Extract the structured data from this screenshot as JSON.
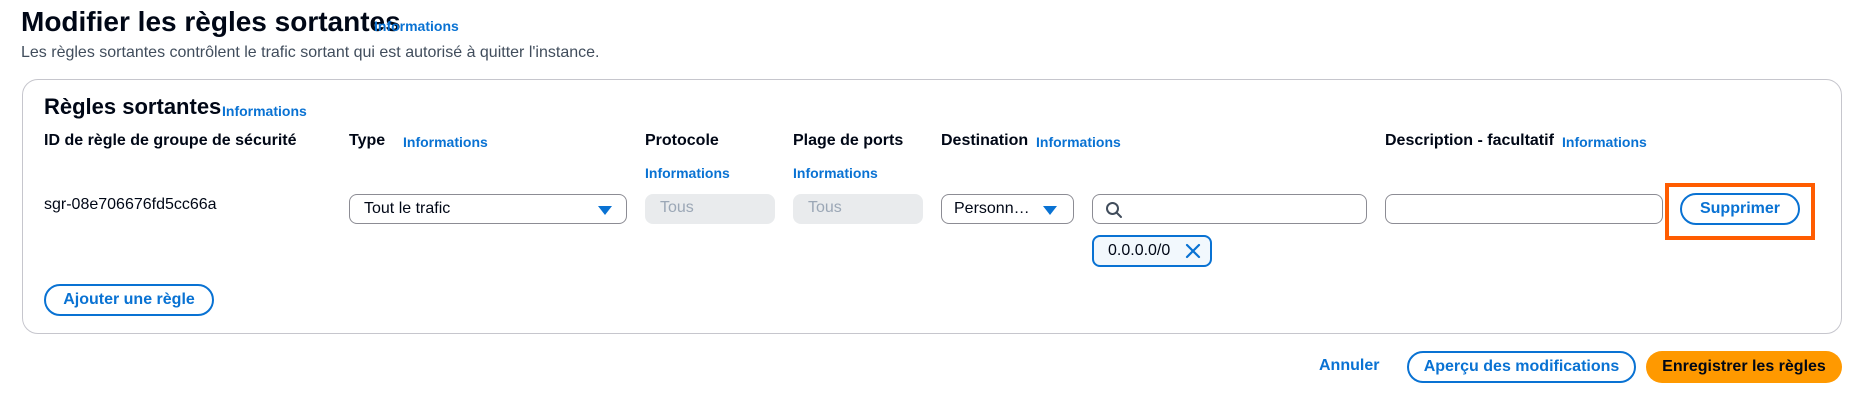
{
  "header": {
    "title": "Modifier les règles sortantes",
    "info_link": "Informations",
    "description": "Les règles sortantes contrôlent le trafic sortant qui est autorisé à quitter l'instance."
  },
  "section": {
    "title": "Règles sortantes",
    "info_link": "Informations",
    "columns": {
      "rule_id": "ID de règle de groupe de sécurité",
      "type": "Type",
      "type_info": "Informations",
      "protocol": "Protocole",
      "protocol_info": "Informations",
      "port_range": "Plage de ports",
      "port_range_info": "Informations",
      "destination": "Destination",
      "destination_info": "Informations",
      "description": "Description - facultatif",
      "description_info": "Informations"
    },
    "rule": {
      "id": "sgr-08e706676fd5cc66a",
      "type": "Tout le trafic",
      "protocol": "Tous",
      "port_range": "Tous",
      "destination_mode": "Personn…",
      "destination_search": "",
      "destination_token": "0.0.0.0/0",
      "description": "",
      "delete_label": "Supprimer"
    },
    "add_rule_label": "Ajouter une règle"
  },
  "footer": {
    "cancel": "Annuler",
    "preview": "Aperçu des modifications",
    "save": "Enregistrer les règles"
  },
  "colors": {
    "accent": "#0972d3",
    "primary_button": "#ff9900",
    "highlight": "#ff5c00"
  },
  "icons": [
    "caret-down-icon",
    "search-icon",
    "close-icon"
  ]
}
